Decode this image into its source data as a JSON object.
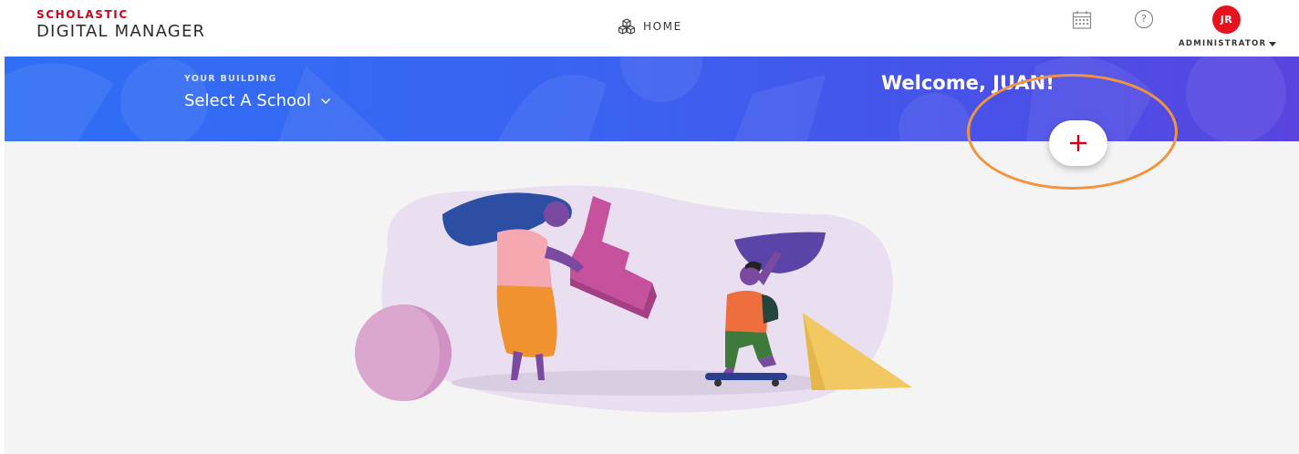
{
  "brand": {
    "top": "SCHOLASTIC",
    "bottom": "DIGITAL MANAGER",
    "accent_color": "#d0021b"
  },
  "nav": {
    "home_label": "HOME",
    "home_icon": "cubes-icon"
  },
  "header_icons": {
    "calendar": "calendar-icon",
    "help": "?"
  },
  "user": {
    "initials": "JR",
    "role": "ADMINISTRATOR",
    "avatar_color": "#e5131d"
  },
  "banner": {
    "building_label": "YOUR BUILDING",
    "school_select": "Select A School",
    "welcome": "Welcome, JUAN!",
    "gradient": [
      "#2f6ff5",
      "#5a44e0"
    ]
  },
  "add_button": {
    "icon": "plus-icon",
    "color": "#d0021b"
  },
  "annotation": {
    "color": "#f09440"
  }
}
